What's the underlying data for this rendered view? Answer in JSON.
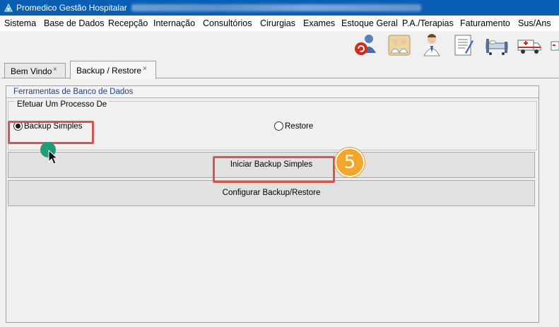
{
  "window": {
    "title": "Promedico Gestão Hospitalar"
  },
  "menubar": {
    "items": [
      "Sistema",
      "Base de Dados",
      "Recepção",
      "Internação",
      "Consultórios",
      "Cirurgias",
      "Exames",
      "Estoque Geral",
      "P.A./Terapias",
      "Faturamento",
      "Sus/Ans"
    ]
  },
  "toolbar": {
    "icons": [
      "refresh-users-icon",
      "doctors-group-icon",
      "doctor-icon",
      "prescription-icon",
      "hospital-bed-icon",
      "ambulance-icon"
    ]
  },
  "tabs": [
    {
      "label": "Bem Vindo",
      "close": "×"
    },
    {
      "label": "Backup / Restore",
      "close": "×"
    }
  ],
  "tools": {
    "header": "Ferramentas de Banco de Dados",
    "group_legend": "Efetuar Um Processo De",
    "options": [
      {
        "label": "Backup Simples",
        "checked": true
      },
      {
        "label": "Restore",
        "checked": false
      }
    ],
    "start_button": "Iniciar Backup Simples",
    "configure_button": "Configurar Backup/Restore"
  },
  "annotation": {
    "step_number": "5",
    "highlight_color": "#d9534f",
    "badge_color": "#f4a62a",
    "click_marker_color": "#1f9a7a"
  },
  "colors": {
    "titlebar": "#0a5fb4",
    "header_text": "#1e3f8a"
  }
}
